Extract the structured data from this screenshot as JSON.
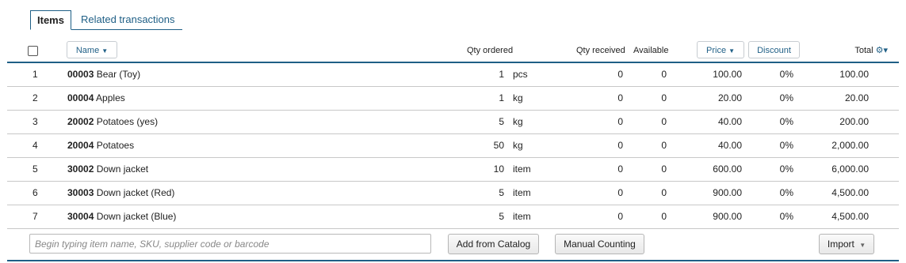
{
  "tabs": [
    {
      "label": "Items",
      "active": true
    },
    {
      "label": "Related transactions",
      "active": false
    }
  ],
  "header": {
    "name": "Name",
    "qty_ordered": "Qty ordered",
    "qty_received": "Qty received",
    "available": "Available",
    "price": "Price",
    "discount": "Discount",
    "total": "Total"
  },
  "rows": [
    {
      "num": "1",
      "sku": "00003",
      "name": "Bear (Toy)",
      "qty": "1",
      "unit": "pcs",
      "received": "0",
      "available": "0",
      "price": "100.00",
      "discount": "0%",
      "total": "100.00"
    },
    {
      "num": "2",
      "sku": "00004",
      "name": "Apples",
      "qty": "1",
      "unit": "kg",
      "received": "0",
      "available": "0",
      "price": "20.00",
      "discount": "0%",
      "total": "20.00"
    },
    {
      "num": "3",
      "sku": "20002",
      "name": "Potatoes (yes)",
      "qty": "5",
      "unit": "kg",
      "received": "0",
      "available": "0",
      "price": "40.00",
      "discount": "0%",
      "total": "200.00"
    },
    {
      "num": "4",
      "sku": "20004",
      "name": "Potatoes",
      "qty": "50",
      "unit": "kg",
      "received": "0",
      "available": "0",
      "price": "40.00",
      "discount": "0%",
      "total": "2,000.00"
    },
    {
      "num": "5",
      "sku": "30002",
      "name": "Down jacket",
      "qty": "10",
      "unit": "item",
      "received": "0",
      "available": "0",
      "price": "600.00",
      "discount": "0%",
      "total": "6,000.00"
    },
    {
      "num": "6",
      "sku": "30003",
      "name": "Down jacket (Red)",
      "qty": "5",
      "unit": "item",
      "received": "0",
      "available": "0",
      "price": "900.00",
      "discount": "0%",
      "total": "4,500.00"
    },
    {
      "num": "7",
      "sku": "30004",
      "name": "Down jacket (Blue)",
      "qty": "5",
      "unit": "item",
      "received": "0",
      "available": "0",
      "price": "900.00",
      "discount": "0%",
      "total": "4,500.00"
    }
  ],
  "footer": {
    "search_placeholder": "Begin typing item name, SKU, supplier code or barcode",
    "add_from_catalog": "Add from Catalog",
    "manual_counting": "Manual Counting",
    "import": "Import"
  },
  "icons": {
    "sort": "chevron-down-icon",
    "settings": "gear-icon",
    "dropdown": "caret-down-icon"
  },
  "colors": {
    "accent": "#1f5f86",
    "row_border": "#c8c8c8"
  }
}
